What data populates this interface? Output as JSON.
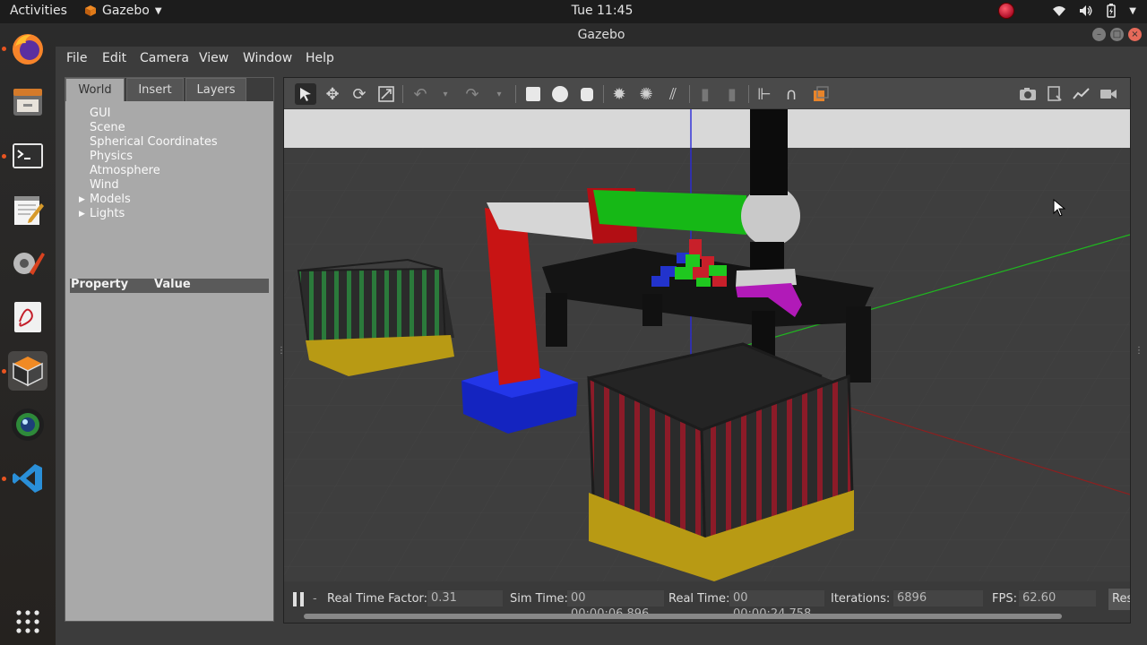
{
  "topbar": {
    "activities": "Activities",
    "app_name": "Gazebo",
    "clock": "Tue 11:45"
  },
  "window": {
    "title": "Gazebo"
  },
  "menu": {
    "file": "File",
    "edit": "Edit",
    "camera": "Camera",
    "view": "View",
    "window": "Window",
    "help": "Help"
  },
  "left_panel": {
    "tabs": [
      "World",
      "Insert",
      "Layers"
    ],
    "active_tab": "World",
    "tree": [
      "GUI",
      "Scene",
      "Spherical Coordinates",
      "Physics",
      "Atmosphere",
      "Wind",
      "Models",
      "Lights"
    ],
    "property_header": "Property",
    "value_header": "Value"
  },
  "status": {
    "real_time_factor_label": "Real Time Factor:",
    "real_time_factor": "0.31",
    "sim_time_label": "Sim Time:",
    "sim_time": "00 00:00:06.896",
    "real_time_label": "Real Time:",
    "real_time": "00 00:00:24.758",
    "iterations_label": "Iterations:",
    "iterations": "6896",
    "fps_label": "FPS:",
    "fps": "62.60",
    "reset_label": "Res"
  },
  "colors": {
    "panel_bg": "#3c3c3c",
    "tree_panel": "#a9a9a9",
    "sky": "#d8d8d8",
    "ground": "#3e3e3e",
    "accent_orange": "#e95420"
  },
  "icons": {
    "dock": [
      "firefox-icon",
      "files-icon",
      "terminal-icon",
      "text-editor-icon",
      "settings-icon",
      "pdf-viewer-icon",
      "gazebo-icon",
      "camera-app-icon",
      "vscode-icon",
      "app-grid-icon"
    ],
    "toolbar": [
      "select-icon",
      "translate-icon",
      "rotate-icon",
      "scale-icon",
      "undo-icon",
      "redo-icon",
      "box-icon",
      "sphere-icon",
      "cylinder-icon",
      "point-light-icon",
      "spot-light-icon",
      "directional-light-icon",
      "copy-icon",
      "paste-icon",
      "align-icon",
      "snap-icon",
      "view-angle-icon",
      "screenshot-icon",
      "log-icon",
      "plot-icon",
      "record-icon"
    ]
  }
}
